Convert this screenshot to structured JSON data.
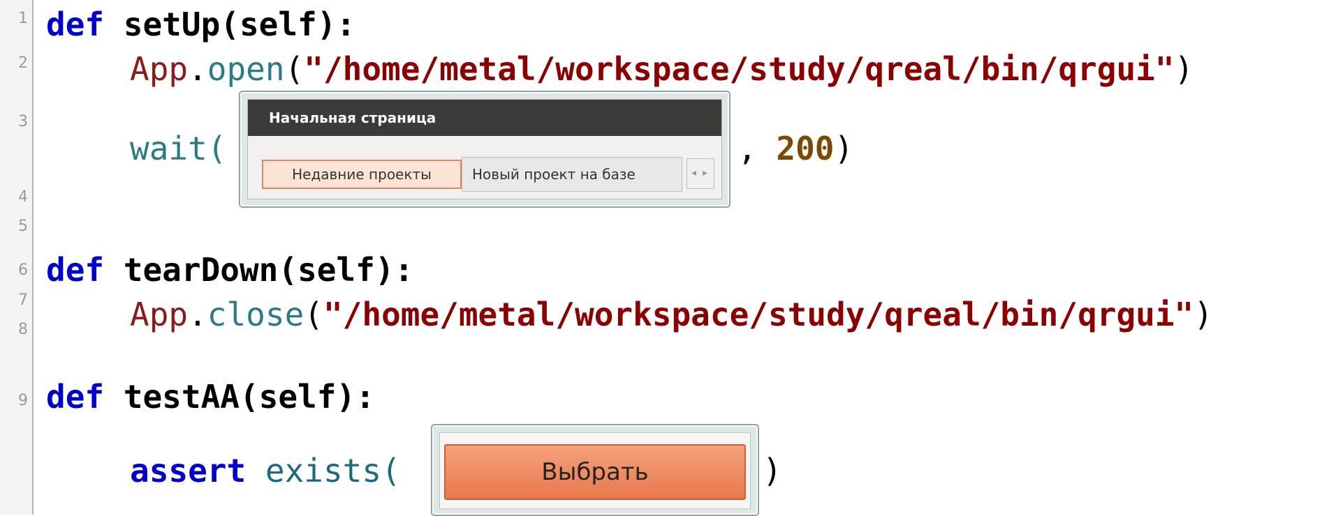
{
  "lines": [
    {
      "num": "1"
    },
    {
      "num": "2"
    },
    {
      "num": "3"
    },
    {
      "num": "4"
    },
    {
      "num": "5"
    },
    {
      "num": "6"
    },
    {
      "num": "7"
    },
    {
      "num": "8"
    },
    {
      "num": "9"
    }
  ],
  "code": {
    "def_kw": "def",
    "setup_sig": "setUp(self):",
    "app": "App",
    "dot": ".",
    "open": "open",
    "paren_open": "(",
    "path": "\"/home/metal/workspace/study/qreal/bin/qrgui\"",
    "paren_close": ")",
    "wait": "wait(",
    "wait_tail": ", ",
    "wait_num": "200",
    "wait_close": ")",
    "teardown_sig": "tearDown(self):",
    "close": "close",
    "testaa_sig": "testAA(self):",
    "assert_kw": "assert",
    "exists": "exists(",
    "exists_close": ")"
  },
  "shot1": {
    "title": "Начальная страница",
    "tab_active": "Недавние проекты",
    "tab_other": "Новый проект на базе",
    "scroll_left": "◂",
    "scroll_right": "▸"
  },
  "shot2": {
    "button_label": "Выбрать"
  }
}
